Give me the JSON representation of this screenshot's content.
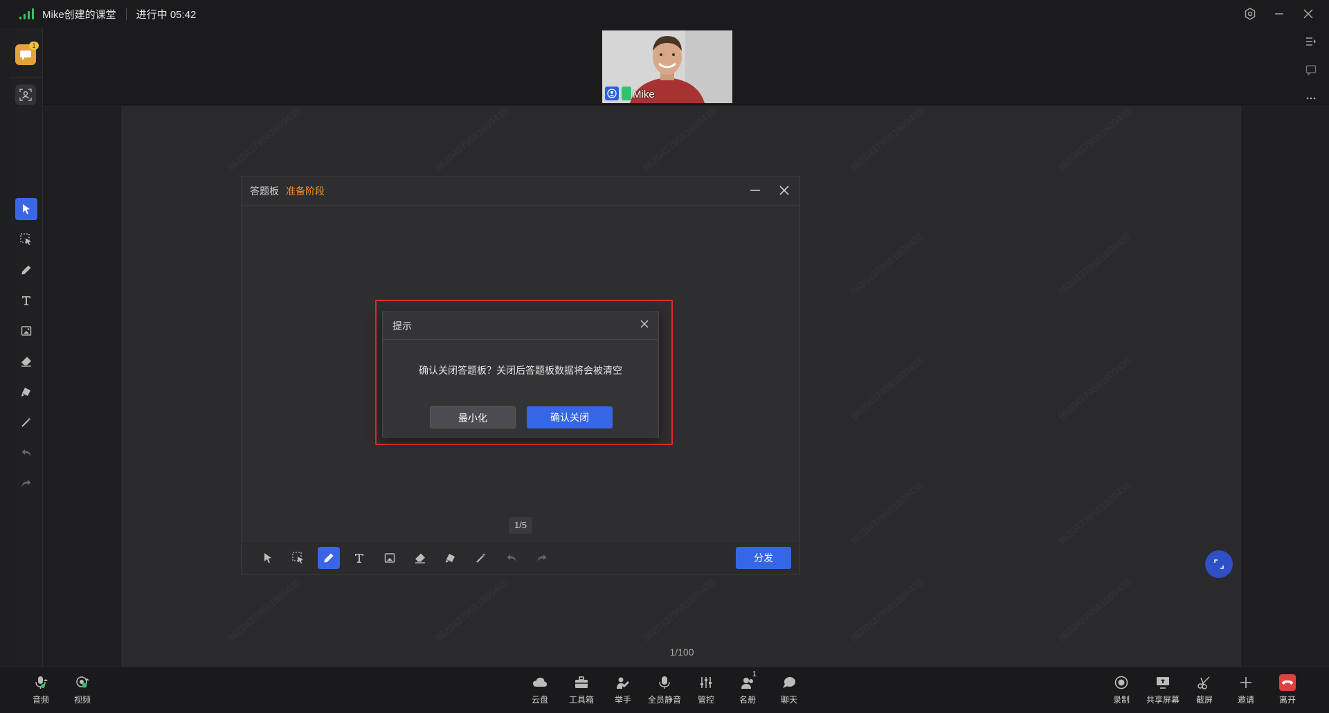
{
  "titlebar": {
    "room_title": "Mike创建的课堂",
    "status": "进行中 05:42"
  },
  "left_strip": {
    "badge_count": "1"
  },
  "video": {
    "participant_name": "Mike"
  },
  "panel": {
    "title": "答题板",
    "stage": "准备阶段",
    "page_indicator": "1/5",
    "distribute_label": "分发"
  },
  "dialog": {
    "title": "提示",
    "message": "确认关闭答题板？关闭后答题板数据将会被清空",
    "minimize_label": "最小化",
    "confirm_label": "确认关闭"
  },
  "board": {
    "page_indicator": "1/100",
    "watermark": "86204379581809435"
  },
  "bottombar": {
    "left": [
      {
        "label": "音频",
        "icon": "mic-icon"
      },
      {
        "label": "视频",
        "icon": "camera-icon"
      }
    ],
    "center": [
      {
        "label": "云盘",
        "icon": "cloud-icon"
      },
      {
        "label": "工具箱",
        "icon": "toolbox-icon"
      },
      {
        "label": "举手",
        "icon": "raise-hand-icon"
      },
      {
        "label": "全员静音",
        "icon": "mute-all-icon"
      },
      {
        "label": "管控",
        "icon": "controls-icon"
      },
      {
        "label": "名册",
        "icon": "roster-icon",
        "badge": "1"
      },
      {
        "label": "聊天",
        "icon": "chat-icon"
      }
    ],
    "right": [
      {
        "label": "录制",
        "icon": "record-icon"
      },
      {
        "label": "共享屏幕",
        "icon": "share-screen-icon"
      },
      {
        "label": "截屏",
        "icon": "screenshot-icon"
      },
      {
        "label": "邀请",
        "icon": "invite-icon"
      },
      {
        "label": "离开",
        "icon": "leave-icon"
      }
    ]
  },
  "colors": {
    "accent": "#3466e6",
    "stage": "#f08a2a",
    "highlight": "#e02c2c",
    "leave": "#e04040"
  }
}
